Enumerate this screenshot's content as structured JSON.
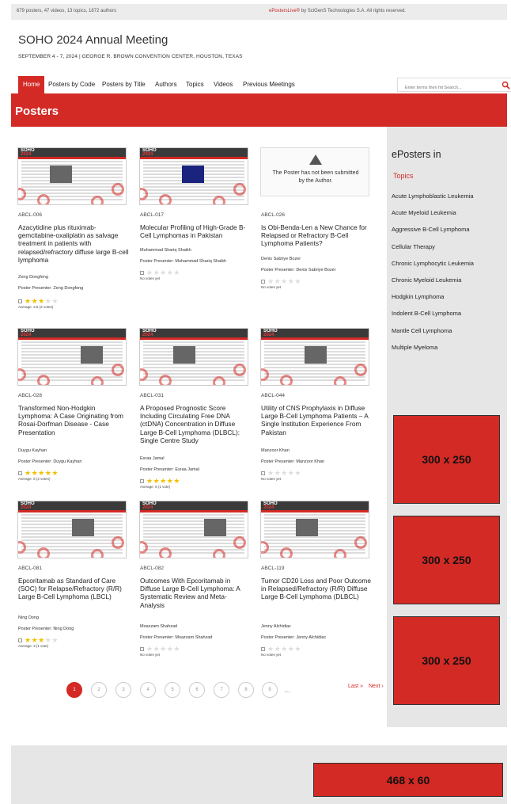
{
  "topbar": {
    "stats": "679 posters, 47 videos, 13 topics, 1872 authors",
    "brand": "ePostersLive®",
    "copyright": " by SciGenS Technologies S.A. All rights reserved."
  },
  "site": {
    "title": "SOHO 2024 Annual Meeting",
    "subtitle": "SEPTEMBER 4 - 7, 2024 | GEORGE R. BROWN CONVENTION CENTER, HOUSTON, TEXAS"
  },
  "nav": {
    "home": "Home",
    "by_code": "Posters by Code",
    "by_title": "Posters by Title",
    "authors": "Authors",
    "topics": "Topics",
    "videos": "Videos",
    "previous": "Previous Meetings",
    "search_placeholder": "Enter terms then hit Search..."
  },
  "banner": {
    "title": "Posters"
  },
  "thumb_logo": {
    "line1": "SOHO",
    "line2": "2024"
  },
  "missing_poster_text": "The Poster has not been submitted by the Author.",
  "posters": [
    {
      "code": "ABCL-006",
      "title": "Azacytidine plus rituximab-gemcitabine-oxaliplatin as salvage treatment in patients with relapsed/refractory diffuse large B-cell lymphoma",
      "author": "Zeng Dongfeng",
      "presenter": "Poster Presenter: Zeng Dongfeng",
      "rating": 3.5,
      "votes": "Average: 3.5 (2 votes)"
    },
    {
      "code": "ABCL-017",
      "title": "Molecular Profiling of High-Grade B-Cell Lymphomas in Pakistan",
      "author": "Muhammad Shariq Shaikh",
      "presenter": "Poster Presenter: Muhammad Shariq Shaikh",
      "rating": 0,
      "votes": "No votes yet"
    },
    {
      "code": "ABCL-026",
      "title": "Is Obi-Benda-Len a New Chance for Relapsed or Refractory B-Cell Lymphoma Patients?",
      "author": "Denis Sabriye Bozer",
      "presenter": "Poster Presenter: Denis Sabriye Bozer",
      "rating": 0,
      "votes": "No votes yet"
    },
    {
      "code": "ABCL-028",
      "title": "Transformed Non-Hodgkin Lymphoma: A Case Originating from Rosai-Dorfman Disease - Case Presentation",
      "author": "Duygu Kayhan",
      "presenter": "Poster Presenter: Duygu Kayhan",
      "rating": 5,
      "votes": "Average: 5 (2 votes)"
    },
    {
      "code": "ABCL-031",
      "title": "A Proposed Prognostic Score Including Circulating Free DNA (ctDNA) Concentration in Diffuse Large B-Cell Lymphoma (DLBCL): Single Centre Study",
      "author": "Esraa Jamal",
      "presenter": "Poster Presenter: Esraa Jamal",
      "rating": 5,
      "votes": "Average: 5 (1 vote)"
    },
    {
      "code": "ABCL-044",
      "title": "Utility of CNS Prophylaxis in Diffuse Large B-Cell Lymphoma Patients – A Single Institution Experience From Pakistan",
      "author": "Manzoor Khan",
      "presenter": "Poster Presenter: Manzoor Khan",
      "rating": 0,
      "votes": "No votes yet"
    },
    {
      "code": "ABCL-081",
      "title": "Epcoritamab as Standard of Care (SOC) for Relapse/Refractory (R/R) Large B-Cell Lymphoma (LBCL)",
      "author": "Ning Dong",
      "presenter": "Poster Presenter: Ning Dong",
      "rating": 3,
      "votes": "Average: 3 (1 vote)"
    },
    {
      "code": "ABCL-082",
      "title": "Outcomes With Epcoritamab in Diffuse Large B-Cell Lymphoma: A Systematic Review and Meta-Analysis",
      "author": "Moazzam Shahzad",
      "presenter": "Poster Presenter: Moazzam Shahzad",
      "rating": 0,
      "votes": "No votes yet"
    },
    {
      "code": "ABCL-119",
      "title": "Tumor CD20 Loss and Poor Outcome in Relapsed/Refractory (R/R) Diffuse Large B-Cell Lymphoma (DLBCL)",
      "author": "Jenny Alchidiac",
      "presenter": "Poster Presenter: Jenny Alchidiac",
      "rating": 0,
      "votes": "No votes yet"
    }
  ],
  "pager": {
    "pages": [
      "1",
      "2",
      "3",
      "4",
      "5",
      "6",
      "7",
      "8",
      "9"
    ],
    "ellipsis": "…",
    "last": "Last »",
    "next": "Next ›"
  },
  "sidebar": {
    "title": "ePosters in",
    "section": "Topics",
    "topics": [
      "Acute Lymphoblastic Leukemia",
      "Acute Myeloid Leukemia",
      "Aggressive B-Cell Lymphoma",
      "Cellular Therapy",
      "Chronic Lymphocytic Leukemia",
      "Chronic Myeloid Leukemia",
      "Hodgkin Lymphoma",
      "Indolent B-Cell Lymphoma",
      "Mantle Cell Lymphoma",
      "Multiple Myeloma"
    ],
    "ads": [
      "300 x 250",
      "300 x 250",
      "300 x 250"
    ]
  },
  "footer": {
    "ad": "468 x 60"
  },
  "colors": {
    "accent": "#d32a25",
    "star": "#f0c000",
    "sidebar_bg": "#e6e6e6"
  }
}
